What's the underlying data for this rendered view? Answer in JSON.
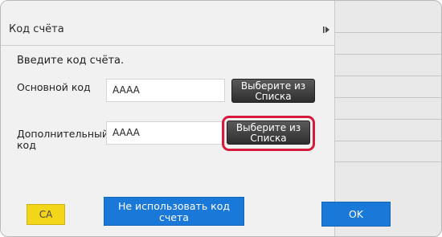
{
  "dialog": {
    "title": "Код счёта",
    "prompt": "Введите код счёта.",
    "main_code": {
      "label": "Основной код",
      "value": "AAAA",
      "button_label": "Выберите из Списка"
    },
    "additional_code": {
      "label": "Дополнительный код",
      "value": "AAAA",
      "button_label": "Выберите из Списка"
    }
  },
  "footer": {
    "ca_label": "CA",
    "no_code_label": "Не использовать код счета",
    "ok_label": "OK"
  },
  "icons": {
    "collapse": "play-bar-icon"
  },
  "colors": {
    "highlight": "#d51a3a",
    "primary_button": "#1a78d9",
    "ca_button": "#f3d51a"
  }
}
